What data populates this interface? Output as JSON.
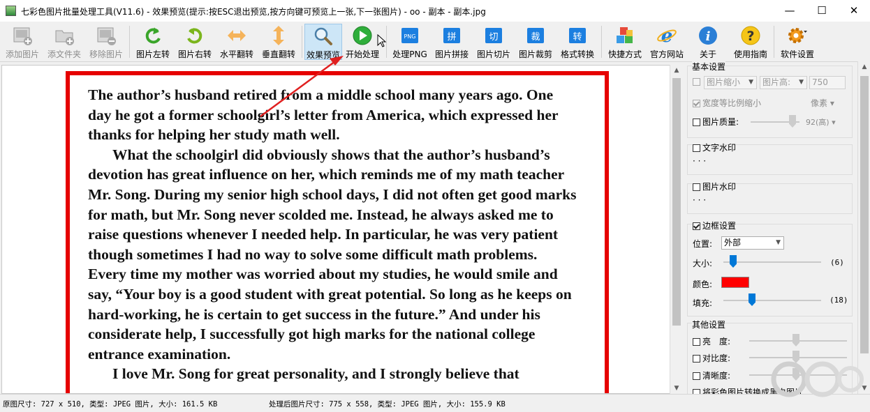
{
  "window": {
    "title": "七彩色图片批量处理工具(V11.6) - 效果预览(提示:按ESC退出预览,按方向键可预览上一张,下一张图片) - oo - 副本 - 副本.jpg",
    "minimize": "—",
    "maximize": "☐",
    "close": "✕"
  },
  "toolbar": {
    "add_image": "添加图片",
    "add_folder": "添文件夹",
    "remove_image": "移除图片",
    "rotate_left": "图片左转",
    "rotate_right": "图片右转",
    "flip_h": "水平翻转",
    "flip_v": "垂直翻转",
    "preview": "效果预览",
    "start": "开始处理",
    "png": "处理PNG",
    "png_badge": "PNG",
    "stitch": "图片拼接",
    "stitch_badge": "拼",
    "slice": "图片切片",
    "slice_badge": "切",
    "crop": "图片裁剪",
    "crop_badge": "裁",
    "convert": "格式转换",
    "convert_badge": "转",
    "shortcut": "快捷方式",
    "website": "官方网站",
    "about": "关于",
    "guide": "使用指南",
    "settings": "软件设置"
  },
  "preview_text": [
    "The author’s husband retired from a middle school many years ago. One day he got a former schoolgirl’s letter from America, which expressed her thanks for helping her study math well.",
    "What the schoolgirl did obviously shows that the author’s husband’s devotion has great influence on her, which reminds me of my math teacher Mr. Song. During my senior high school days, I did not often get good marks for math, but Mr. Song never scolded me. Instead, he always asked me to raise questions whenever I needed help. In particular, he was very patient though sometimes I had no way to solve some difficult math problems. Every time my mother was worried about my studies, he would smile and say, “Your boy is a good student with great potential. So long as he keeps on hard-working, he is certain to get success in the future.” And under his considerate help, I successfully got high marks for the national college entrance examination.",
    "I love Mr. Song for great personality, and I strongly believe that"
  ],
  "settings": {
    "basic": {
      "title": "基本设置",
      "shrink": "图片缩小",
      "height": "图片高:",
      "height_value": "750",
      "keep_ratio": "宽度等比例缩小",
      "unit": "像素",
      "quality": "图片质量:",
      "quality_value": "92(高)"
    },
    "text_watermark": {
      "title": "文字水印",
      "dots": "· · ·"
    },
    "image_watermark": {
      "title": "图片水印",
      "dots": "· · ·"
    },
    "border": {
      "title": "边框设置",
      "position_label": "位置:",
      "position_value": "外部",
      "size_label": "大小:",
      "size_value": "(6)",
      "color_label": "颜色:",
      "color": "#ff0000",
      "fill_label": "填充:",
      "fill_value": "(18)"
    },
    "other": {
      "title": "其他设置",
      "brightness": "亮　度:",
      "contrast": "对比度:",
      "clarity": "清晰度:",
      "grayscale": "将彩色图片转换成黑白图片"
    }
  },
  "status": {
    "original": "原图尺寸: 727 x 510, 类型: JPEG 图片, 大小: 161.5 KB",
    "processed": "处理后图片尺寸: 775 x 558, 类型: JPEG 图片, 大小: 155.9 KB"
  },
  "colors": {
    "border_red": "#e60000",
    "accent_blue": "#0078d7",
    "arrow_red": "#e02020"
  }
}
